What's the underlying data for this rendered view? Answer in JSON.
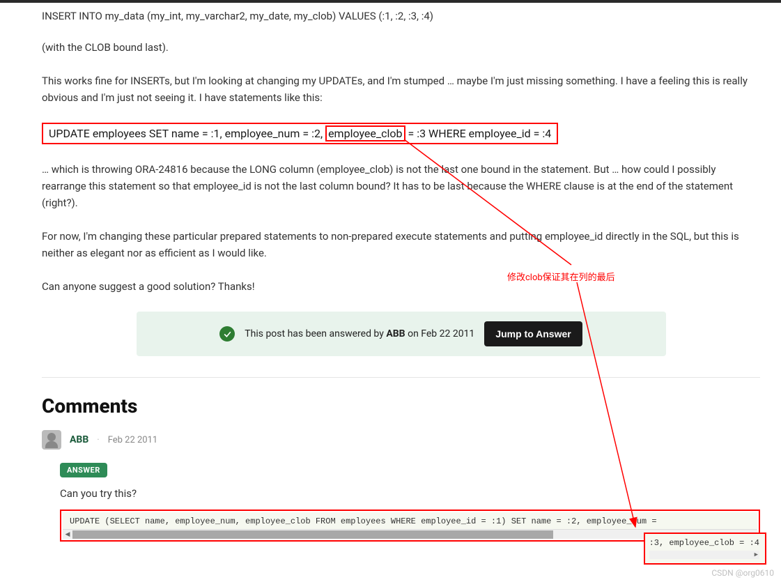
{
  "post": {
    "insert_line": "INSERT INTO my_data (my_int, my_varchar2, my_date, my_clob) VALUES (:1, :2, :3, :4)",
    "clob_note": "(with the CLOB bound last).",
    "paragraph1": "This works fine for INSERTs, but I'm looking at changing my UPDATEs, and I'm stumped … maybe I'm just missing something. I have a feeling this is really obvious and I'm just not seeing it. I have statements like this:",
    "update_line_pre": "UPDATE employees SET name = :1, employee_num = :2, ",
    "update_line_clob": "employee_clob",
    "update_line_post": " = :3 WHERE employee_id = :4",
    "paragraph2": "… which is throwing ORA-24816 because the LONG column (employee_clob) is not the last one bound in the statement. But … how could I possibly rearrange this statement so that employee_id is not the last column bound? It has to be last because the WHERE clause is at the end of the statement (right?).",
    "paragraph3": "For now, I'm changing these particular prepared statements to non-prepared execute statements and putting employee_id directly in the SQL, but this is neither as elegant nor as efficient as I would like.",
    "paragraph4": "Can anyone suggest a good solution? Thanks!"
  },
  "banner": {
    "text_pre": "This post has been answered by ",
    "author": "ABB",
    "text_post": " on Feb 22 2011",
    "button": "Jump to Answer"
  },
  "comments": {
    "heading": "Comments",
    "author": "ABB",
    "date": "Feb 22 2011",
    "badge": "ANSWER",
    "try_text": "Can you try this?",
    "code_main": "UPDATE (SELECT name, employee_num, employee_clob FROM employees WHERE employee_id = :1) SET name = :2, employee_num = ",
    "code_end": ":3, employee_clob = :4"
  },
  "annotation": "修改clob保证其在列的最后",
  "watermark": "CSDN @org0610"
}
